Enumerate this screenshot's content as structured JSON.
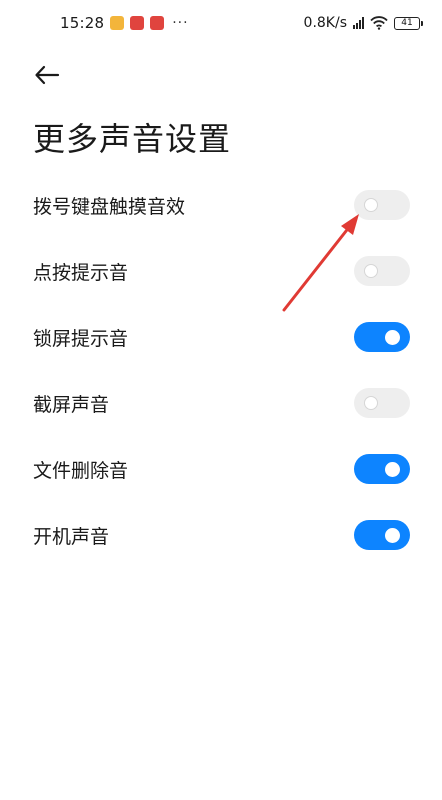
{
  "status": {
    "time": "15:28",
    "network_speed": "0.8K/s",
    "battery": "41"
  },
  "header": {
    "title": "更多声音设置"
  },
  "settings": [
    {
      "label": "拨号键盘触摸音效",
      "on": false
    },
    {
      "label": "点按提示音",
      "on": false
    },
    {
      "label": "锁屏提示音",
      "on": true
    },
    {
      "label": "截屏声音",
      "on": false
    },
    {
      "label": "文件删除音",
      "on": true
    },
    {
      "label": "开机声音",
      "on": true
    }
  ],
  "colors": {
    "accent": "#0d84ff",
    "toggle_off": "#e7e7e7",
    "annotation": "#e03a34"
  },
  "icons": {
    "back": "arrow-left-icon",
    "wifi": "wifi-icon",
    "signal": "signal-icon",
    "battery": "battery-icon"
  }
}
